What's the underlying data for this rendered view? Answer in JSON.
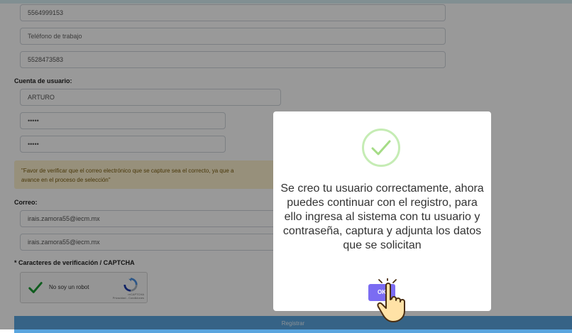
{
  "form": {
    "phone_value": "5564999153",
    "work_phone_placeholder": "Teléfono de trabajo",
    "work_phone_value": "5528473583",
    "user_account_label": "Cuenta de usuario:",
    "username_value": "ARTURO",
    "password_value": "•••••",
    "password_confirm_value": "•••••",
    "alert_text": "\"Favor de verificar que el correo electrónico que se capture sea el correcto, ya que a",
    "alert_text_line2": "avance en el proceso de selección\"",
    "email_label": "Correo:",
    "email_value": "irais.zamora55@iecm.mx",
    "email_confirm_value": "irais.zamora55@iecm.mx",
    "captcha_label": "* Caracteres de verificación / CAPTCHA",
    "captcha_text": "No soy un robot",
    "captcha_brand": "reCAPTCHA",
    "captcha_links": "Privacidad - Condiciones",
    "register_label": "Registrar"
  },
  "modal": {
    "icon": "success-check-icon",
    "message": "Se creo tu usuario correctamente, ahora puedes continuar con el registro, para ello ingresa al sistema con tu usuario y contraseña, captura y adjunta los datos que se solicitan",
    "ok_label": "OK"
  },
  "colors": {
    "accent": "#7b6cf2",
    "success": "#a5dc86",
    "register": "#5aa5df",
    "alert_bg": "#fcf1cd"
  }
}
